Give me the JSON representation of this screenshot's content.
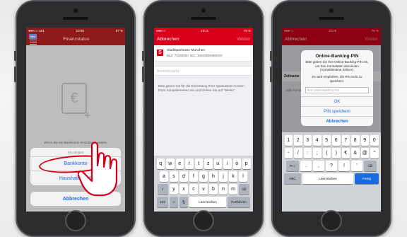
{
  "phone1": {
    "status": {
      "carrier": "●●●○○ 1&1",
      "time": "10:05",
      "battery": "87 %"
    },
    "nav": {
      "badge": "Neu",
      "title": "Finanzstatus"
    },
    "empty_text": "Wenn Sie ein Bankkonto hinzufügen wollen,",
    "sheet": {
      "title": "Hinzufügen",
      "options": [
        "Bankkonto",
        "Haushaltsbüch"
      ]
    },
    "cancel_label": "Abbrechen",
    "icons": [
      "menu-icon",
      "wallet-euro-icon",
      "plus-icon",
      "pointing-hand-icon"
    ]
  },
  "phone2": {
    "status": {
      "carrier": "●●●○○",
      "time": "10:11",
      "battery": "79 %"
    },
    "nav": {
      "left": "Abbrechen",
      "right": "Weiter"
    },
    "bank": {
      "name": "Stadtsparkasse München",
      "blz": "BLZ: 70150000",
      "bic": "BIC: SSKMDEMMXXX",
      "logo": "S"
    },
    "field_placeholder": "Anmeldename",
    "hint": "Bitte geben Sie für die Einrichtung Ihrer Sparkassen-Konten Ihren Anmeldenamen ein und klicken Sie auf \"Weiter\".",
    "keyboard": {
      "row1": [
        "q",
        "w",
        "e",
        "r",
        "t",
        "z",
        "u",
        "i",
        "o",
        "p"
      ],
      "row2": [
        "a",
        "s",
        "d",
        "f",
        "g",
        "h",
        "j",
        "k",
        "l"
      ],
      "row3": [
        "y",
        "x",
        "c",
        "v",
        "b",
        "n",
        "m"
      ],
      "bottom": {
        "num": "123",
        "space": "Leerzeichen",
        "action": "Fortfahren"
      }
    }
  },
  "phone3": {
    "status": {
      "carrier": "●●●○○",
      "time": "10:28",
      "battery": "75 %"
    },
    "nav": {
      "left": "Abbrechen",
      "right": "Weiter"
    },
    "row_label": "Zeilname",
    "behind_text": "Bitte Konte \"Wei",
    "alert": {
      "title": "Online-Banking-PIN",
      "message": "Bitte geben Sie Ihre Online-Banking-PIN ein, um Ihre Kontodaten abzuholen (Anmeldename Zeliner).",
      "message2": "Es wird empfohlen, die PIN nicht zu speichern.",
      "pin_placeholder": "Ihre Online-Banking-PIN",
      "buttons": {
        "ok": "OK",
        "save": "PIN speichern",
        "cancel": "Abbrechen"
      }
    },
    "keyboard": {
      "row1": [
        "1",
        "2",
        "3",
        "4",
        "5",
        "6",
        "7",
        "8",
        "9",
        "0"
      ],
      "row2": [
        "-",
        "/",
        ":",
        ";",
        "(",
        ")",
        "€",
        "&",
        "@",
        "\""
      ],
      "row3": [
        ".",
        ",",
        "?",
        "!",
        "'"
      ],
      "bottom": {
        "abc": "ABC",
        "space": "Leerzeichen",
        "action": "Fertig"
      }
    }
  }
}
